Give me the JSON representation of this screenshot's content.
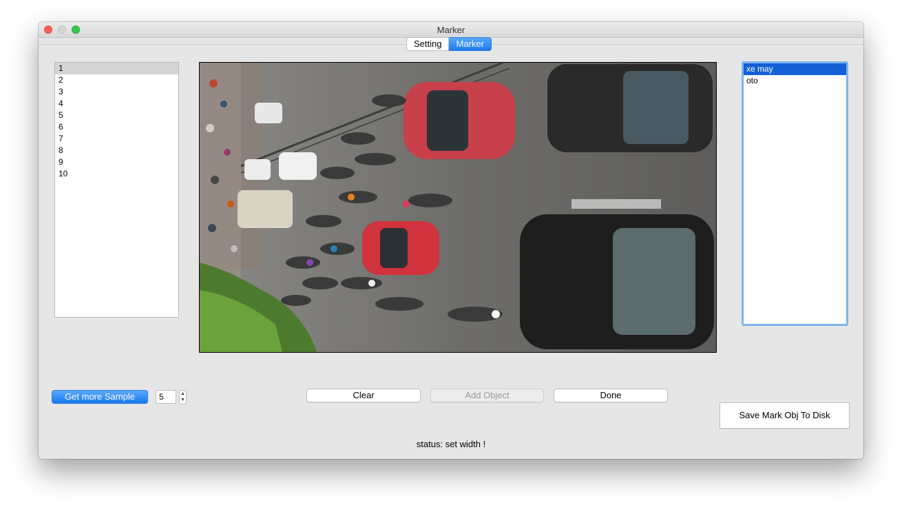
{
  "window": {
    "title": "Marker"
  },
  "tabs": [
    {
      "label": "Setting",
      "active": false
    },
    {
      "label": "Marker",
      "active": true
    }
  ],
  "sample_list": {
    "items": [
      "1",
      "2",
      "3",
      "4",
      "5",
      "6",
      "7",
      "8",
      "9",
      "10"
    ],
    "selected": "1"
  },
  "object_list": {
    "items": [
      "xe may",
      "oto"
    ],
    "selected": "xe may"
  },
  "image_view": {
    "icon": "street-traffic-photo"
  },
  "controls": {
    "get_more_sample": "Get more Sample",
    "sample_count": "5",
    "clear": "Clear",
    "add_object": "Add Object",
    "done": "Done",
    "save": "Save Mark Obj To Disk"
  },
  "status": "status: set width !",
  "colors": {
    "accent": "#1a78f0",
    "selection": "#1360d6",
    "window_bg": "#e6e6e6"
  }
}
